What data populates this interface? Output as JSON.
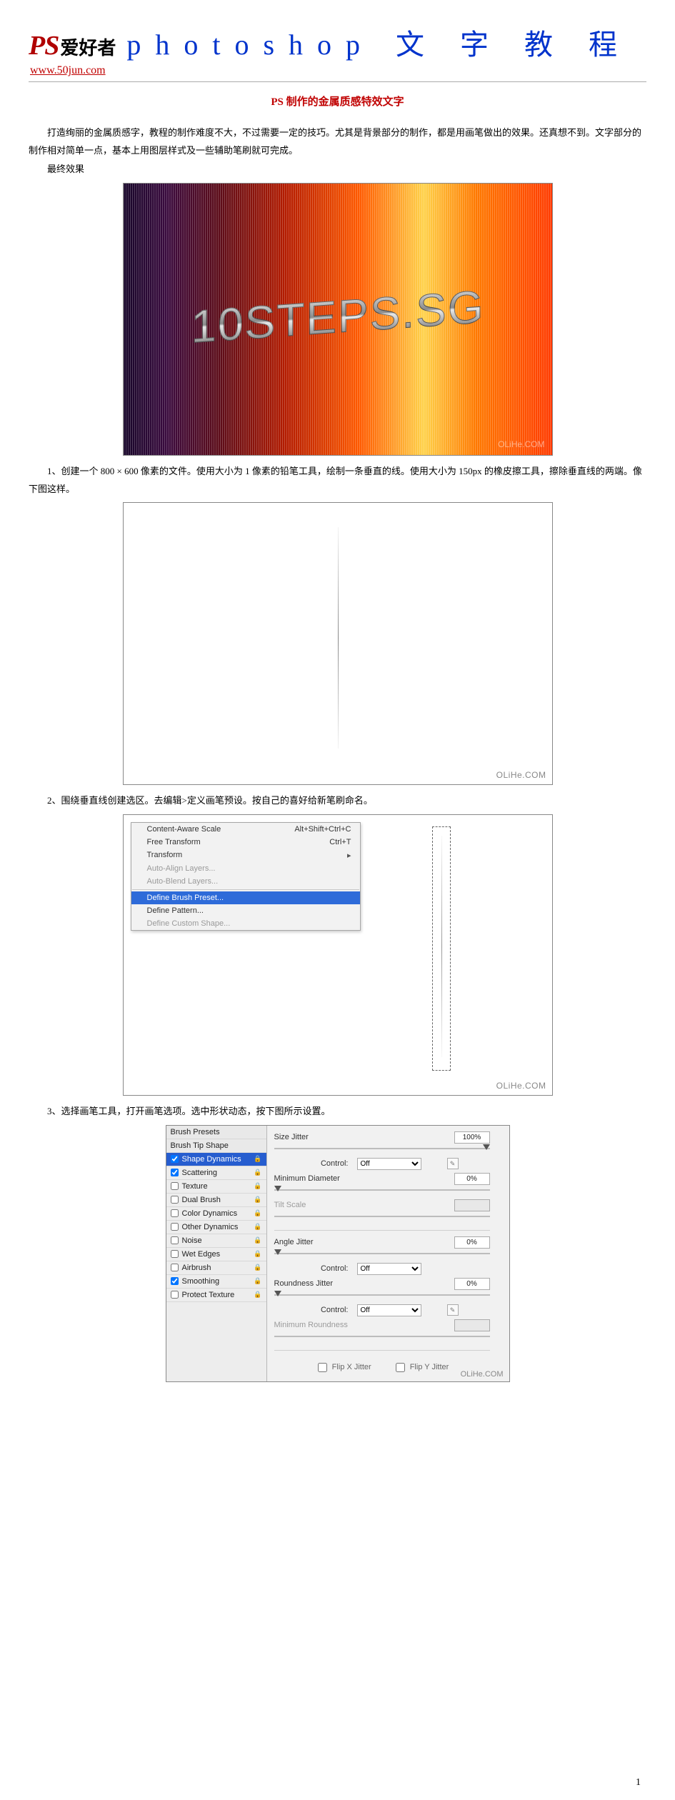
{
  "header": {
    "logo_ps": "PS",
    "logo_cn": "爱好者",
    "title": "photoshop 文 字 教 程",
    "site_url": "www.50jun.com"
  },
  "article": {
    "title": "PS 制作的金属质感特效文字",
    "intro": "打造绚丽的金属质感字，教程的制作难度不大，不过需要一定的技巧。尤其是背景部分的制作，都是用画笔做出的效果。还真想不到。文字部分的制作相对简单一点，基本上用图层样式及一些辅助笔刷就可完成。",
    "final_label": "最终效果"
  },
  "fig1": {
    "text": "10STEPS.SG",
    "watermark": "OLiHe.COM"
  },
  "steps": {
    "s1": "1、创建一个 800 × 600 像素的文件。使用大小为 1 像素的铅笔工具，绘制一条垂直的线。使用大小为 150px 的橡皮擦工具，擦除垂直线的两端。像下图这样。",
    "s2": "2、围绕垂直线创建选区。去编辑>定义画笔预设。按自己的喜好给新笔刷命名。",
    "s3": "3、选择画笔工具，打开画笔选项。选中形状动态，按下图所示设置。"
  },
  "fig2": {
    "watermark": "OLiHe.COM"
  },
  "fig3": {
    "menu": {
      "content_aware_scale": "Content-Aware Scale",
      "content_aware_scale_key": "Alt+Shift+Ctrl+C",
      "free_transform": "Free Transform",
      "free_transform_key": "Ctrl+T",
      "transform": "Transform",
      "auto_align": "Auto-Align Layers...",
      "auto_blend": "Auto-Blend Layers...",
      "define_brush": "Define Brush Preset...",
      "define_pattern": "Define Pattern...",
      "define_shape": "Define Custom Shape..."
    },
    "watermark": "OLiHe.COM"
  },
  "brush_panel": {
    "left": {
      "brush_presets": "Brush Presets",
      "brush_tip_shape": "Brush Tip Shape",
      "shape_dynamics": "Shape Dynamics",
      "scattering": "Scattering",
      "texture": "Texture",
      "dual_brush": "Dual Brush",
      "color_dynamics": "Color Dynamics",
      "other_dynamics": "Other Dynamics",
      "noise": "Noise",
      "wet_edges": "Wet Edges",
      "airbrush": "Airbrush",
      "smoothing": "Smoothing",
      "protect_texture": "Protect Texture"
    },
    "right": {
      "size_jitter": "Size Jitter",
      "size_jitter_val": "100%",
      "control": "Control:",
      "control_val": "Off",
      "min_diameter": "Minimum Diameter",
      "min_diameter_val": "0%",
      "tilt_scale": "Tilt Scale",
      "angle_jitter": "Angle Jitter",
      "angle_jitter_val": "0%",
      "roundness_jitter": "Roundness Jitter",
      "roundness_jitter_val": "0%",
      "min_roundness": "Minimum Roundness",
      "flip_x": "Flip X Jitter",
      "flip_y": "Flip Y Jitter"
    },
    "watermark": "OLiHe.COM"
  },
  "page_number": "1"
}
